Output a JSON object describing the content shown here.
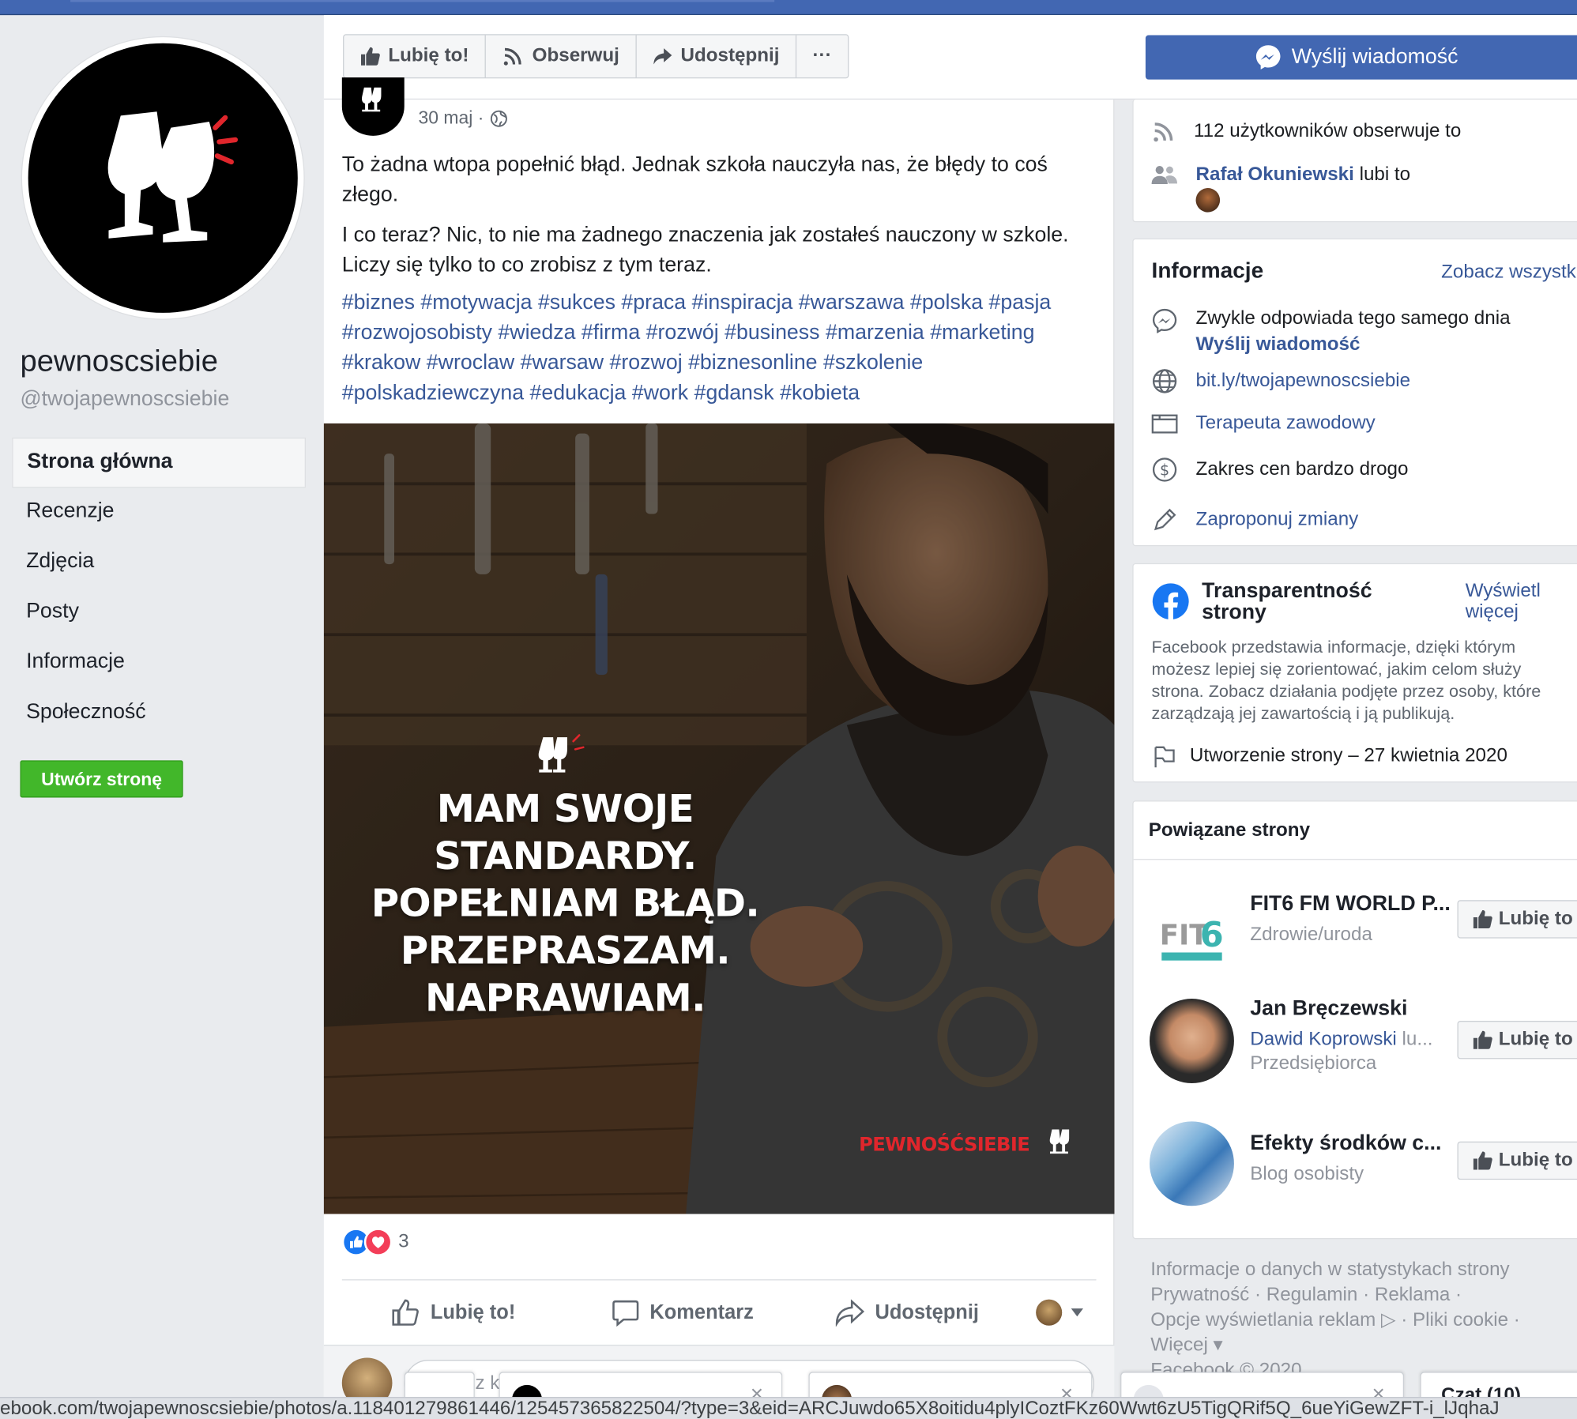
{
  "left": {
    "page_name": "pewnoscsiebie",
    "page_handle": "@twojapewnoscsiebie",
    "nav": [
      {
        "label": "Strona główna",
        "active": true
      },
      {
        "label": "Recenzje"
      },
      {
        "label": "Zdjęcia"
      },
      {
        "label": "Posty"
      },
      {
        "label": "Informacje"
      },
      {
        "label": "Społeczność"
      }
    ],
    "create_page": "Utwórz stronę"
  },
  "actionbar": {
    "like": "Lubię to!",
    "follow": "Obserwuj",
    "share": "Udostępnij",
    "more": "···",
    "message": "Wyślij wiadomość"
  },
  "post": {
    "date": "30 maj ·",
    "paragraph1": "To żadna wtopa popełnić błąd. Jednak szkoła nauczyła nas, że błędy to coś złego.",
    "paragraph2": "I co teraz? Nic, to nie ma żadnego znaczenia jak zostałeś nauczony w szkole. Liczy się tylko to co zrobisz z tym teraz.",
    "hashtags": "#biznes #motywacja #sukces #praca #inspiracja #warszawa #polska #pasja #rozwojosobisty #wiedza #firma #rozwój #business #marzenia #marketing #krakow #wroclaw #warsaw #rozwoj #biznesonline #szkolenie #polskadziewczyna #edukacja #work #gdansk #kobieta",
    "image_text": [
      "MAM SWOJE",
      "STANDARDY.",
      "POPEŁNIAM BŁĄD.",
      "PRZEPRASZAM.",
      "NAPRAWIAM."
    ],
    "image_brand": "PEWNOŚĆSIEBIE",
    "reaction_count": "3",
    "actions": {
      "like": "Lubię to!",
      "comment": "Komentarz",
      "share": "Udostępnij"
    },
    "comment_placeholder": "sz k"
  },
  "community": {
    "followers": "112 użytkowników obserwuje to",
    "liker_name": "Rafał Okuniewski",
    "liker_suffix": "lubi to"
  },
  "info": {
    "title": "Informacje",
    "see_all": "Zobacz wszystk",
    "response": "Zwykle odpowiada tego samego dnia",
    "send_message": "Wyślij wiadomość",
    "website": "bit.ly/twojapewnoscsiebie",
    "category": "Terapeuta zawodowy",
    "price": "Zakres cen bardzo drogo",
    "suggest": "Zaproponuj zmiany"
  },
  "transparency": {
    "title": "Transparentność strony",
    "more": "Wyświetl więcej",
    "text": "Facebook przedstawia informacje, dzięki którym możesz lepiej się zorientować, jakim celom służy strona. Zobacz działania podjęte przez osoby, które zarządzają jej zawartością i ją publikują.",
    "created": "Utworzenie strony – 27 kwietnia 2020"
  },
  "related": {
    "title": "Powiązane strony",
    "items": [
      {
        "name": "FIT6 FM WORLD P...",
        "sub": "Zdrowie/uroda",
        "like": "Lubię to"
      },
      {
        "name": "Jan Bręczewski",
        "friend": "Dawid Koprowski",
        "friend_suffix": "lu...",
        "sub": "Przedsiębiorca",
        "like": "Lubię to"
      },
      {
        "name": "Efekty środków c...",
        "sub": "Blog osobisty",
        "like": "Lubię to"
      }
    ]
  },
  "footer": {
    "line1": "Informacje o danych w statystykach strony",
    "line2": "Prywatność · Regulamin · Reklama ·",
    "line3": "Opcje wyświetlania reklam ▷ · Pliki cookie ·",
    "line4": "Więcej ▾",
    "line5": "Facebook © 2020"
  },
  "statusbar": {
    "url": "ebook.com/twojapewnoscsiebie/photos/a.118401279861446/125457365822504/?type=3&eid=ARCJuwdo65X8oitidu4plyICoztFKz60Wwt6zU5TigQRif5Q_6ueYiGewZFT-i_lJqhaJ"
  },
  "chat_tabs": [
    "",
    "",
    "",
    "Czat (10)"
  ],
  "colors": {
    "fb_blue": "#4267b2",
    "link": "#385898",
    "green": "#42b72a",
    "brand_red": "#e0262c"
  }
}
